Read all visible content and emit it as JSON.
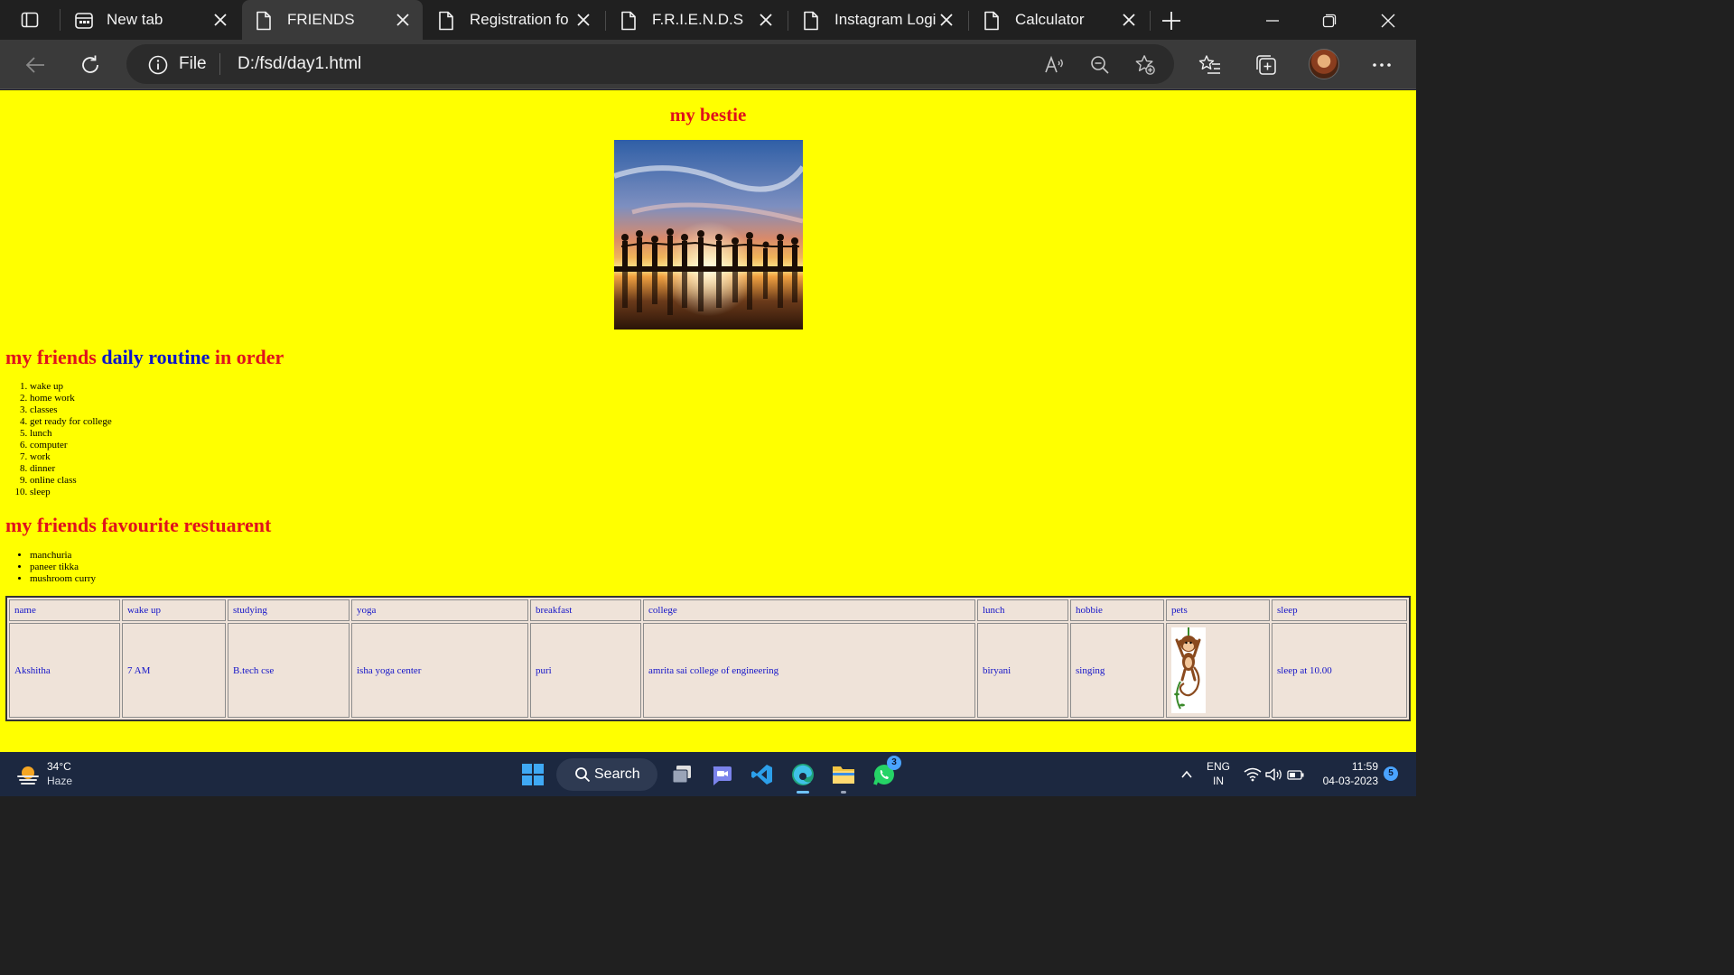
{
  "browser": {
    "tabs": [
      {
        "title": "New tab",
        "active": false
      },
      {
        "title": "FRIENDS",
        "active": true
      },
      {
        "title": "Registration fo",
        "active": false
      },
      {
        "title": "F.R.I.E.N.D.S",
        "active": false
      },
      {
        "title": "Instagram Logi",
        "active": false
      },
      {
        "title": "Calculator",
        "active": false
      }
    ],
    "address": {
      "scheme": "File",
      "url": "D:/fsd/day1.html"
    }
  },
  "page": {
    "background_color": "#ffff00",
    "title": "my bestie",
    "routine_heading": {
      "part1": "my friends",
      "part2": "daily routine",
      "part3": "in order"
    },
    "routine_items": [
      "wake up",
      "home work",
      "classes",
      "get ready for college",
      "lunch",
      "computer",
      "work",
      "dinner",
      "online class",
      "sleep"
    ],
    "restaurant_heading": "my friends favourite restuarent",
    "restaurant_items": [
      "manchuria",
      "paneer tikka",
      "mushroom curry"
    ],
    "table": {
      "headers": [
        "name",
        "wake up",
        "studying",
        "yoga",
        "breakfast",
        "college",
        "lunch",
        "hobbie",
        "pets",
        "sleep"
      ],
      "row": [
        "Akshitha",
        "7 AM",
        "B.tech cse",
        "isha yoga center",
        "puri",
        "amrita sai college of engineering",
        "biryani",
        "singing",
        "",
        "sleep at 10.00"
      ]
    }
  },
  "taskbar": {
    "weather": {
      "temp": "34°C",
      "desc": "Haze"
    },
    "search_label": "Search",
    "whatsapp_badge": "3",
    "lang": {
      "line1": "ENG",
      "line2": "IN"
    },
    "clock": {
      "time": "11:59",
      "date": "04-03-2023"
    },
    "notification_count": "5"
  }
}
